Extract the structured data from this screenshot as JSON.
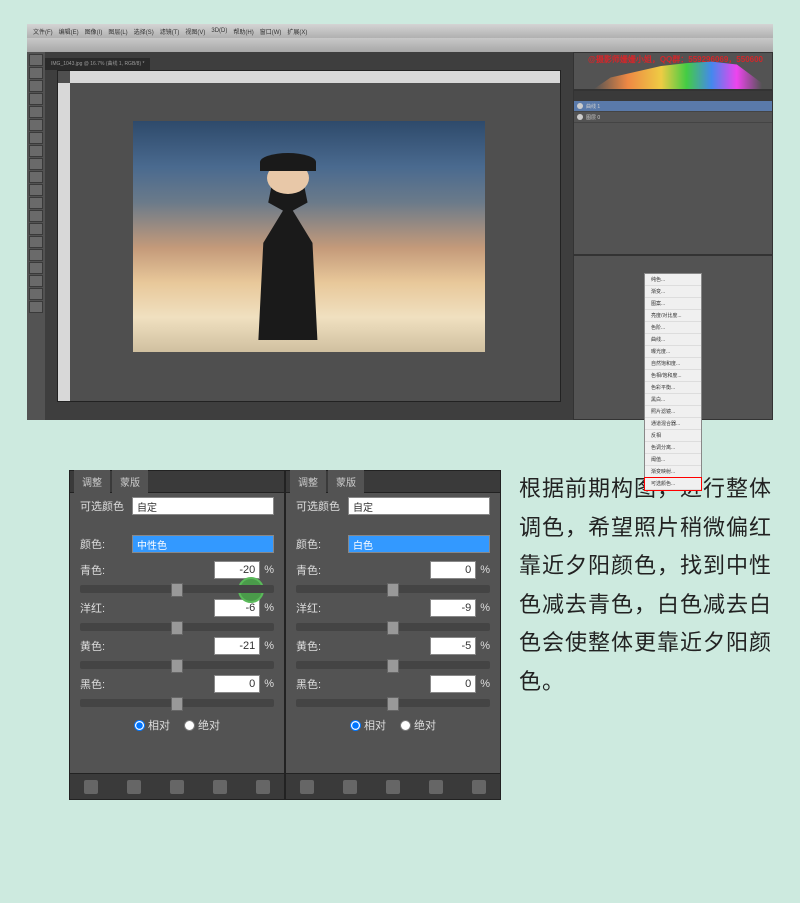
{
  "menubar": [
    "文件(F)",
    "编辑(E)",
    "图像(I)",
    "图层(L)",
    "选择(S)",
    "滤镜(T)",
    "视图(V)",
    "3D(D)",
    "帮助(H)",
    "窗口(W)",
    "扩展(X)"
  ],
  "watermark": "@摄影师姗姗小姐，QQ群：559296069，550600",
  "doc_tab": "IMG_1043.jpg @ 16.7% (曲线 1, RGB/8) *",
  "adjustments_menu": [
    "纯色...",
    "渐变...",
    "图案...",
    "亮度/对比度...",
    "色阶...",
    "曲线...",
    "曝光度...",
    "自然饱和度...",
    "色相/饱和度...",
    "色彩平衡...",
    "黑白...",
    "照片滤镜...",
    "通道混合器...",
    "反相",
    "色调分离...",
    "阈值...",
    "渐变映射...",
    "可选颜色..."
  ],
  "layer_items": [
    "曲线 1",
    "图层 0"
  ],
  "panelA": {
    "tabs": [
      "调整",
      "蒙版"
    ],
    "title": "可选颜色",
    "preset": "自定",
    "color_label": "颜色:",
    "color_value": "中性色",
    "sliders": [
      {
        "name": "青色:",
        "value": "-20"
      },
      {
        "name": "洋红:",
        "value": "-6"
      },
      {
        "name": "黄色:",
        "value": "-21"
      },
      {
        "name": "黑色:",
        "value": "0"
      }
    ],
    "radio": {
      "rel": "相对",
      "abs": "绝对"
    }
  },
  "panelB": {
    "tabs": [
      "调整",
      "蒙版"
    ],
    "title": "可选颜色",
    "preset": "自定",
    "color_label": "颜色:",
    "color_value": "白色",
    "sliders": [
      {
        "name": "青色:",
        "value": "0"
      },
      {
        "name": "洋红:",
        "value": "-9"
      },
      {
        "name": "黄色:",
        "value": "-5"
      },
      {
        "name": "黑色:",
        "value": "0"
      }
    ],
    "radio": {
      "rel": "相对",
      "abs": "绝对"
    }
  },
  "description": "根据前期构图，进行整体调色，希望照片稍微偏红靠近夕阳颜色，找到中性色减去青色，白色减去白色会使整体更靠近夕阳颜色。"
}
